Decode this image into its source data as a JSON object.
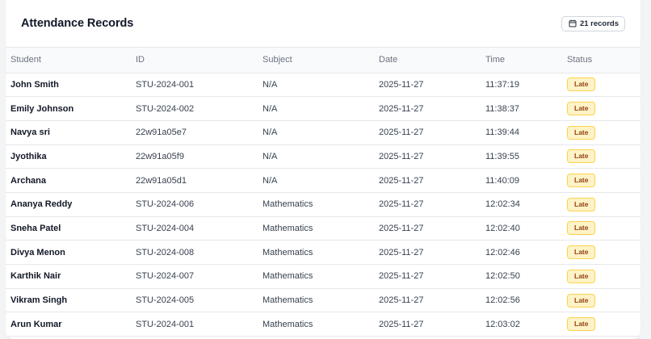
{
  "header": {
    "title": "Attendance Records",
    "records_count": "21 records"
  },
  "table": {
    "columns": [
      "Student",
      "ID",
      "Subject",
      "Date",
      "Time",
      "Status"
    ],
    "rows": [
      {
        "student": "John Smith",
        "id": "STU-2024-001",
        "subject": "N/A",
        "date": "2025-11-27",
        "time": "11:37:19",
        "status": "Late"
      },
      {
        "student": "Emily Johnson",
        "id": "STU-2024-002",
        "subject": "N/A",
        "date": "2025-11-27",
        "time": "11:38:37",
        "status": "Late"
      },
      {
        "student": "Navya sri",
        "id": "22w91a05e7",
        "subject": "N/A",
        "date": "2025-11-27",
        "time": "11:39:44",
        "status": "Late"
      },
      {
        "student": "Jyothika",
        "id": "22w91a05f9",
        "subject": "N/A",
        "date": "2025-11-27",
        "time": "11:39:55",
        "status": "Late"
      },
      {
        "student": "Archana",
        "id": "22w91a05d1",
        "subject": "N/A",
        "date": "2025-11-27",
        "time": "11:40:09",
        "status": "Late"
      },
      {
        "student": "Ananya Reddy",
        "id": "STU-2024-006",
        "subject": "Mathematics",
        "date": "2025-11-27",
        "time": "12:02:34",
        "status": "Late"
      },
      {
        "student": "Sneha Patel",
        "id": "STU-2024-004",
        "subject": "Mathematics",
        "date": "2025-11-27",
        "time": "12:02:40",
        "status": "Late"
      },
      {
        "student": "Divya Menon",
        "id": "STU-2024-008",
        "subject": "Mathematics",
        "date": "2025-11-27",
        "time": "12:02:46",
        "status": "Late"
      },
      {
        "student": "Karthik Nair",
        "id": "STU-2024-007",
        "subject": "Mathematics",
        "date": "2025-11-27",
        "time": "12:02:50",
        "status": "Late"
      },
      {
        "student": "Vikram Singh",
        "id": "STU-2024-005",
        "subject": "Mathematics",
        "date": "2025-11-27",
        "time": "12:02:56",
        "status": "Late"
      },
      {
        "student": "Arun Kumar",
        "id": "STU-2024-001",
        "subject": "Mathematics",
        "date": "2025-11-27",
        "time": "12:03:02",
        "status": "Late"
      }
    ]
  },
  "icons": {
    "records_badge": "calendar-icon"
  },
  "colors": {
    "late_bg": "#fef3c7",
    "late_text": "#92400e",
    "late_border": "#fcd34d"
  }
}
